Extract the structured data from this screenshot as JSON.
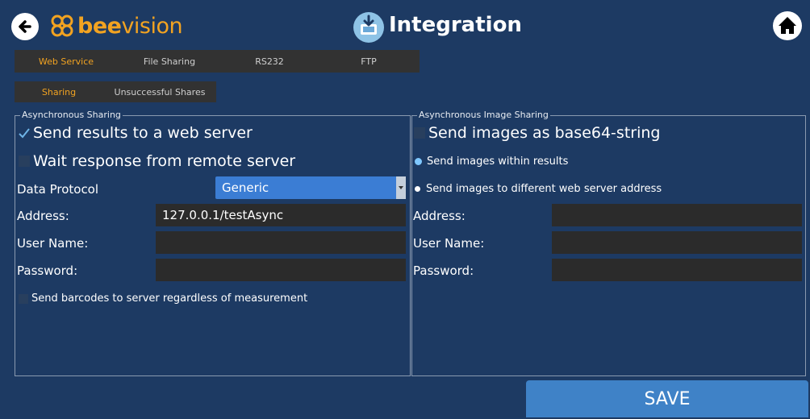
{
  "header": {
    "logo_bold": "bee",
    "logo_light": "vision",
    "title": "Integration"
  },
  "tabs": [
    {
      "label": "Web Service",
      "active": true
    },
    {
      "label": "File Sharing",
      "active": false
    },
    {
      "label": "RS232",
      "active": false
    },
    {
      "label": "FTP",
      "active": false
    }
  ],
  "subtabs": [
    {
      "label": "Sharing",
      "active": true
    },
    {
      "label": "Unsuccessful Shares",
      "active": false
    }
  ],
  "left_panel": {
    "legend": "Asynchronous Sharing",
    "send_results_label": "Send results to a web server",
    "send_results_checked": true,
    "wait_response_label": "Wait response from remote server",
    "wait_response_checked": false,
    "protocol_label": "Data Protocol",
    "protocol_value": "Generic",
    "address_label": "Address:",
    "address_value": "127.0.0.1/testAsync",
    "username_label": "User Name:",
    "username_value": "",
    "password_label": "Password:",
    "password_value": "",
    "send_barcodes_label": "Send barcodes to server regardless of measurement",
    "send_barcodes_checked": false
  },
  "right_panel": {
    "legend": "Asynchronous Image Sharing",
    "base64_label": "Send images as base64-string",
    "base64_checked": false,
    "within_results_label": "Send images within results",
    "within_results_selected": true,
    "different_server_label": "Send images to different web server address",
    "different_server_selected": false,
    "address_label": "Address:",
    "address_value": "",
    "username_label": "User Name:",
    "username_value": "",
    "password_label": "Password:",
    "password_value": ""
  },
  "save_label": "SAVE",
  "colors": {
    "background": "#1d3a63",
    "accent_orange": "#f2a321",
    "save_button": "#3f82c7",
    "dropdown": "#3b7dd4",
    "field": "#2b2b2b"
  }
}
